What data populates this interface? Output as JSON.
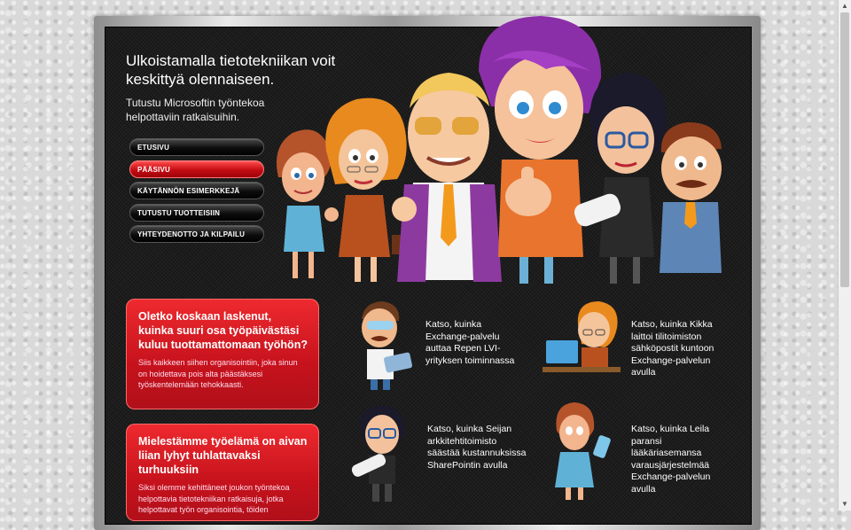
{
  "header": {
    "headline": "Ulkoistamalla tietotekniikan voit keskittyä olennaiseen.",
    "subline": "Tutustu Microsoftin työntekoa helpottaviin ratkaisuihin."
  },
  "nav": {
    "items": [
      {
        "label": "ETUSIVU"
      },
      {
        "label": "PÄÄSIVU"
      },
      {
        "label": "KÄYTÄNNÖN ESIMERKKEJÄ"
      },
      {
        "label": "TUTUSTU TUOTTEISIIN"
      },
      {
        "label": "YHTEYDENOTTO JA KILPAILU"
      }
    ],
    "active_color": "#d0141c"
  },
  "cards": [
    {
      "title": "Oletko koskaan laskenut, kuinka suuri osa työpäivästäsi kuluu tuottamattomaan työhön?",
      "body": "Siis kaikkeen siihen organisointiin, joka sinun on hoidettava pois alta päästäksesi työskentelemään tehokkaasti."
    },
    {
      "title": "Mielestämme työelämä on aivan liian lyhyt tuhlattavaksi turhuuksiin",
      "body": "Siksi olemme kehittäneet joukon työntekoa helpottavia tietotekniikan ratkaisuja, jotka helpottavat työn organisointia, töiden"
    }
  ],
  "cases": [
    {
      "text": "Katso, kuinka Exchange-palvelu auttaa Repen LVI-yrityksen toiminnassa",
      "icon": "plumber-laptop-icon"
    },
    {
      "text": "Katso, kuinka Kikka laittoi tilitoimiston sähköpostit kuntoon Exchange-palvelun avulla",
      "icon": "accountant-desk-icon"
    },
    {
      "text": "Katso, kuinka Seijan arkkitehtitoimisto säästää kustannuksissa SharePointin avulla",
      "icon": "architect-blueprints-icon"
    },
    {
      "text": "Katso, kuinka Leila paransi lääkäriasemansa varausjärjestelmää Exchange-palvelun avulla",
      "icon": "doctor-phone-icon"
    }
  ],
  "colors": {
    "accent_red": "#d0141c",
    "board": "#1c1c1c",
    "purple_hair": "#8b2fa8"
  }
}
